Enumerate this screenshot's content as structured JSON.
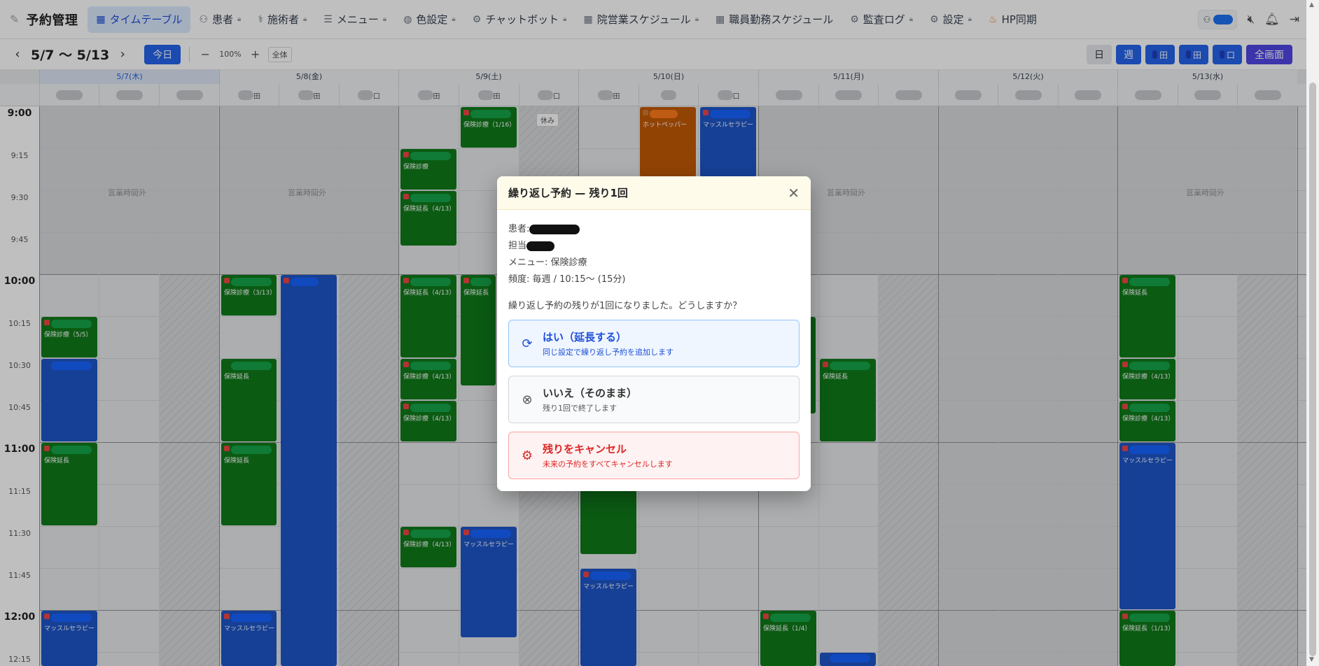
{
  "app": {
    "title": "予約管理"
  },
  "nav": {
    "items": [
      {
        "label": "タイムテーブル",
        "locked": false
      },
      {
        "label": "患者",
        "locked": true
      },
      {
        "label": "施術者",
        "locked": true
      },
      {
        "label": "メニュー",
        "locked": true
      },
      {
        "label": "色設定",
        "locked": true
      },
      {
        "label": "チャットボット",
        "locked": true
      },
      {
        "label": "院営業スケジュール",
        "locked": true
      },
      {
        "label": "職員勤務スケジュール",
        "locked": false
      },
      {
        "label": "監査ログ",
        "locked": true
      },
      {
        "label": "設定",
        "locked": true
      },
      {
        "label": "HP同期",
        "locked": false
      }
    ]
  },
  "toolbar": {
    "range": "5/7 〜 5/13",
    "today": "今日",
    "zoom": "100%",
    "all": "全体",
    "views": {
      "day": "日",
      "week": "週",
      "staff1": "田",
      "staff2": "田",
      "staff3": "口",
      "full": "全画面"
    }
  },
  "grid": {
    "days": [
      "5/7(木)",
      "5/8(金)",
      "5/9(土)",
      "5/10(日)",
      "5/11(月)",
      "5/12(火)",
      "5/13(水)"
    ],
    "times": [
      "9:00",
      "9:15",
      "9:30",
      "9:45",
      "10:00",
      "10:15",
      "10:30",
      "10:45",
      "11:00",
      "11:15",
      "11:30",
      "11:45",
      "12:00",
      "12:15"
    ],
    "off_label": "営業時間外",
    "rest_label": "休み",
    "staff_marks": {
      "d1a": "田",
      "d1b": "田",
      "d1c": "口",
      "d2a": "田",
      "d2b": "田",
      "d2c": "口",
      "d3a": "田",
      "d3c": "口"
    },
    "labels": {
      "hoken_shinryo": "保険診療",
      "hoken_shinryo_116": "保険診療（1/16）",
      "hoken_encho": "保険延長",
      "hoken_encho_413": "保険延長（4/13）",
      "hoken_shinryo_413": "保険診療（4/13）",
      "hoken_shinryo_313": "保険診療（3/13）",
      "hoken_shinryo_55": "保険診療（5/5）",
      "hoken_encho_14": "保険延長（1/4）",
      "hoken_encho_113": "保険延長（1/13）",
      "muscle": "マッスルセラピー",
      "hotpepper": "ホットペッパー"
    }
  },
  "modal": {
    "title": "繰り返し予約 — 残り1回",
    "patient_label": "患者:",
    "staff_label": "担当",
    "menu": "メニュー: 保険診療",
    "frequency": "頻度: 毎週 / 10:15〜 (15分)",
    "question": "繰り返し予約の残りが1回になりました。どうしますか？",
    "options": [
      {
        "title": "はい（延長する）",
        "sub": "同じ設定で繰り返し予約を追加します"
      },
      {
        "title": "いいえ（そのまま）",
        "sub": "残り1回で終了します"
      },
      {
        "title": "残りをキャンセル",
        "sub": "未来の予約をすべてキャンセルします"
      }
    ]
  },
  "colors": {
    "primary": "#2563eb",
    "green": "#0f7a1a",
    "blue": "#1e56c8",
    "orange": "#f06a0a",
    "danger": "#dc2626"
  }
}
